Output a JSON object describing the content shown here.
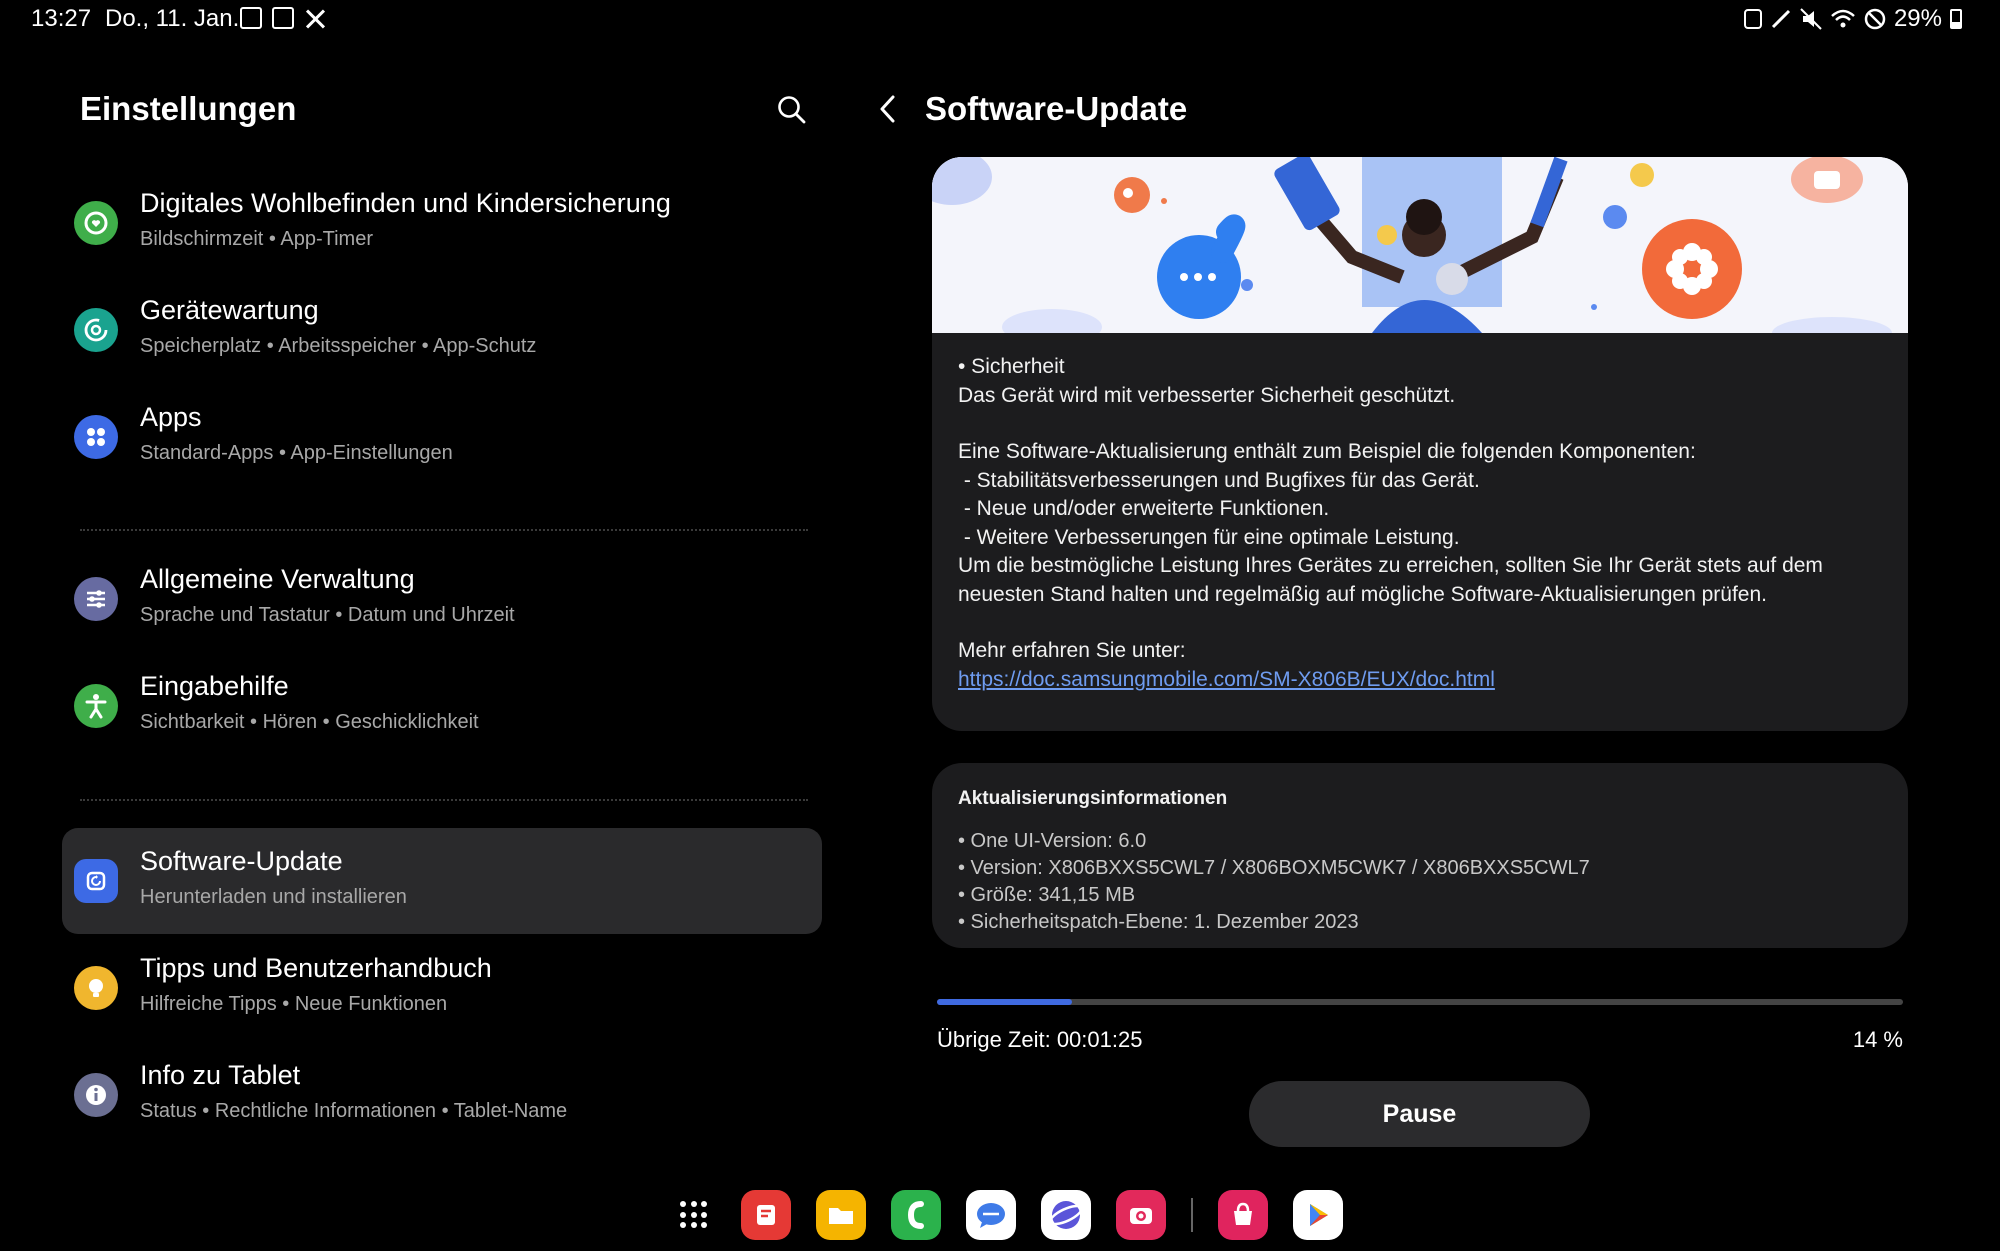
{
  "status_bar": {
    "time": "13:27",
    "date": "Do., 11. Jan.",
    "battery": "29%"
  },
  "settings": {
    "title": "Einstellungen",
    "items": [
      {
        "title": "Digitales Wohlbefinden und Kindersicherung",
        "subtitle": "Bildschirmzeit  •  App-Timer",
        "color": "#3fae4a",
        "icon": "wellbeing-icon"
      },
      {
        "title": "Gerätewartung",
        "subtitle": "Speicherplatz  •  Arbeitsspeicher  •  App-Schutz",
        "color": "#1aa38f",
        "icon": "device-care-icon"
      },
      {
        "title": "Apps",
        "subtitle": "Standard-Apps  •  App-Einstellungen",
        "color": "#3d6ae5",
        "icon": "apps-icon"
      },
      {
        "title": "Allgemeine Verwaltung",
        "subtitle": "Sprache und Tastatur  •  Datum und Uhrzeit",
        "color": "#676ba1",
        "icon": "general-management-icon"
      },
      {
        "title": "Eingabehilfe",
        "subtitle": "Sichtbarkeit  •  Hören  •  Geschicklichkeit",
        "color": "#3fae4a",
        "icon": "accessibility-icon"
      },
      {
        "title": "Software-Update",
        "subtitle": "Herunterladen und installieren",
        "color": "#3d6ae5",
        "icon": "software-update-icon"
      },
      {
        "title": "Tipps und Benutzerhandbuch",
        "subtitle": "Hilfreiche Tipps  •  Neue Funktionen",
        "color": "#f0b62e",
        "icon": "tips-icon"
      },
      {
        "title": "Info zu Tablet",
        "subtitle": "Status  •  Rechtliche Informationen  •  Tablet-Name",
        "color": "#6b6f92",
        "icon": "info-icon"
      }
    ]
  },
  "update": {
    "title": "Software-Update",
    "notes": {
      "heading": "• Sicherheit",
      "security": "Das Gerät wird mit verbesserter Sicherheit geschützt.",
      "components_intro": "Eine Software-Aktualisierung enthält zum Beispiel die folgenden Komponenten:",
      "c1": " - Stabilitätsverbesserungen und Bugfixes für das Gerät.",
      "c2": " - Neue und/oder erweiterte Funktionen.",
      "c3": " - Weitere Verbesserungen für eine optimale Leistung.",
      "advice": "Um die bestmögliche Leistung Ihres Gerätes zu erreichen, sollten Sie Ihr Gerät stets auf dem neuesten Stand halten und regelmäßig auf mögliche Software-Aktualisierungen prüfen.",
      "more": "Mehr erfahren Sie unter:",
      "link": "https://doc.samsungmobile.com/SM-X806B/EUX/doc.html"
    },
    "info": {
      "title": "Aktualisierungsinformationen",
      "oneui": "• One UI-Version: 6.0",
      "version": "• Version: X806BXXS5CWL7 / X806BOXM5CWK7 / X806BXXS5CWL7",
      "size": "• Größe: 341,15 MB",
      "patch": "• Sicherheitspatch-Ebene: 1. Dezember 2023"
    },
    "progress": 0.14,
    "remaining": "Übrige Zeit: 00:01:25",
    "percent": "14 %",
    "pause_label": "Pause"
  },
  "dock": {
    "apps": [
      {
        "icon": "notes-icon",
        "color": "#e53935"
      },
      {
        "icon": "files-icon",
        "color": "#f5b400"
      },
      {
        "icon": "phone-icon",
        "color": "#2bb24c"
      },
      {
        "icon": "messages-icon",
        "color": "#3f7be8"
      },
      {
        "icon": "internet-icon",
        "color": "#5b55d9"
      },
      {
        "icon": "camera-icon",
        "color": "#e2295b"
      },
      {
        "icon": "galaxy-store-icon",
        "color": "#e0245e"
      },
      {
        "icon": "play-store-icon",
        "color": "#ffffff"
      }
    ]
  }
}
